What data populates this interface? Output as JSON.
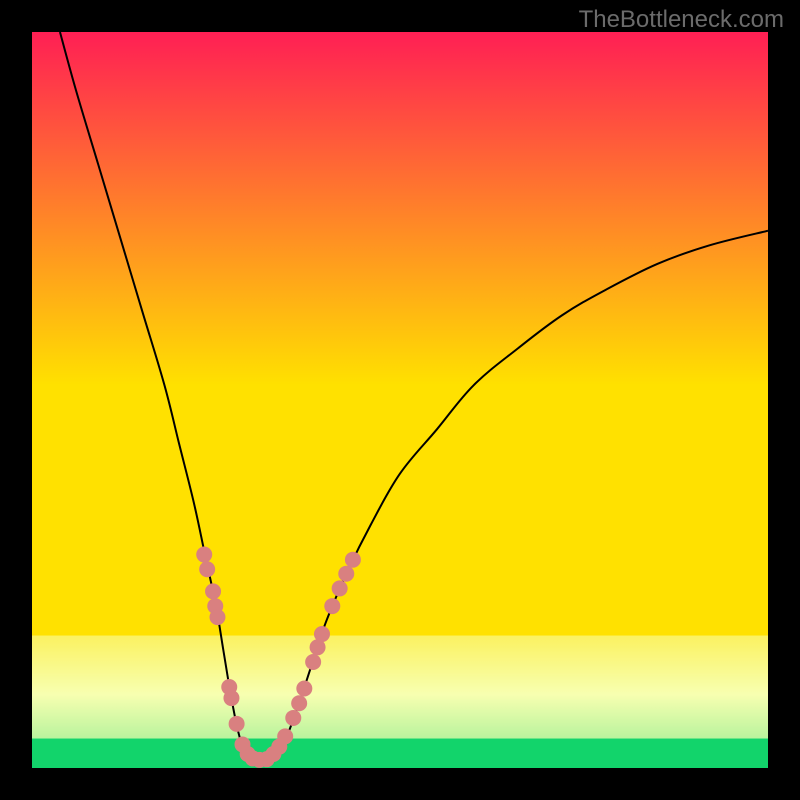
{
  "watermark": "TheBottleneck.com",
  "chart_data": {
    "type": "line",
    "title": "",
    "xlabel": "",
    "ylabel": "",
    "xlim": [
      0,
      100
    ],
    "ylim": [
      0,
      100
    ],
    "background_gradient": {
      "top": "#ff1f54",
      "mid": "#ffe100",
      "lower": "#f7ffb0",
      "bottom": "#12d46b"
    },
    "green_band_y": [
      0,
      4
    ],
    "pale_band_y": [
      4,
      18
    ],
    "curve": {
      "description": "V-shaped bottleneck curve; steep descent on left, minimum around x≈30, rising right branch approaching y≈73 at x=100",
      "points": [
        {
          "x": 3.8,
          "y": 100.0
        },
        {
          "x": 6.0,
          "y": 92.0
        },
        {
          "x": 9.0,
          "y": 82.0
        },
        {
          "x": 12.0,
          "y": 72.0
        },
        {
          "x": 15.0,
          "y": 62.0
        },
        {
          "x": 18.0,
          "y": 52.0
        },
        {
          "x": 20.0,
          "y": 44.0
        },
        {
          "x": 22.0,
          "y": 36.0
        },
        {
          "x": 23.5,
          "y": 29.0
        },
        {
          "x": 25.0,
          "y": 22.0
        },
        {
          "x": 26.0,
          "y": 16.0
        },
        {
          "x": 27.0,
          "y": 10.0
        },
        {
          "x": 28.0,
          "y": 5.0
        },
        {
          "x": 29.0,
          "y": 2.0
        },
        {
          "x": 30.0,
          "y": 1.0
        },
        {
          "x": 32.0,
          "y": 1.2
        },
        {
          "x": 34.0,
          "y": 3.0
        },
        {
          "x": 36.0,
          "y": 8.0
        },
        {
          "x": 38.0,
          "y": 14.0
        },
        {
          "x": 40.0,
          "y": 20.0
        },
        {
          "x": 43.0,
          "y": 27.0
        },
        {
          "x": 46.0,
          "y": 33.0
        },
        {
          "x": 50.0,
          "y": 40.0
        },
        {
          "x": 55.0,
          "y": 46.0
        },
        {
          "x": 60.0,
          "y": 52.0
        },
        {
          "x": 66.0,
          "y": 57.0
        },
        {
          "x": 72.0,
          "y": 61.5
        },
        {
          "x": 78.0,
          "y": 65.0
        },
        {
          "x": 85.0,
          "y": 68.5
        },
        {
          "x": 92.0,
          "y": 71.0
        },
        {
          "x": 100.0,
          "y": 73.0
        }
      ]
    },
    "markers": {
      "color": "#d98080",
      "radius_px": 8,
      "points": [
        {
          "x": 23.4,
          "y": 29.0
        },
        {
          "x": 23.8,
          "y": 27.0
        },
        {
          "x": 24.6,
          "y": 24.0
        },
        {
          "x": 24.9,
          "y": 22.0
        },
        {
          "x": 25.2,
          "y": 20.5
        },
        {
          "x": 26.8,
          "y": 11.0
        },
        {
          "x": 27.1,
          "y": 9.5
        },
        {
          "x": 27.8,
          "y": 6.0
        },
        {
          "x": 28.6,
          "y": 3.2
        },
        {
          "x": 29.3,
          "y": 1.9
        },
        {
          "x": 30.0,
          "y": 1.3
        },
        {
          "x": 30.9,
          "y": 1.1
        },
        {
          "x": 31.9,
          "y": 1.2
        },
        {
          "x": 32.8,
          "y": 1.9
        },
        {
          "x": 33.6,
          "y": 2.9
        },
        {
          "x": 34.4,
          "y": 4.3
        },
        {
          "x": 35.5,
          "y": 6.8
        },
        {
          "x": 36.3,
          "y": 8.8
        },
        {
          "x": 37.0,
          "y": 10.8
        },
        {
          "x": 38.2,
          "y": 14.4
        },
        {
          "x": 38.8,
          "y": 16.4
        },
        {
          "x": 39.4,
          "y": 18.2
        },
        {
          "x": 40.8,
          "y": 22.0
        },
        {
          "x": 41.8,
          "y": 24.4
        },
        {
          "x": 42.7,
          "y": 26.4
        },
        {
          "x": 43.6,
          "y": 28.3
        }
      ]
    }
  }
}
